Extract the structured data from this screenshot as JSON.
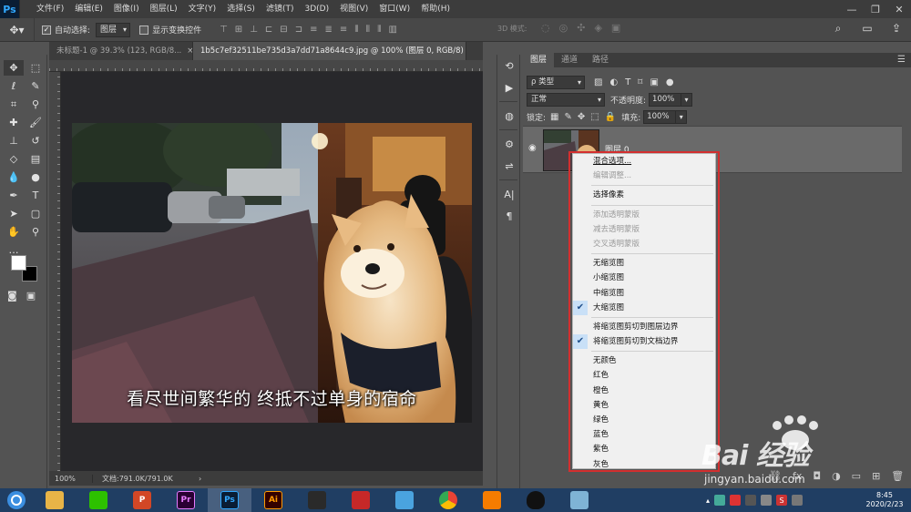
{
  "app": {
    "logo": "Ps"
  },
  "menu": [
    "文件(F)",
    "编辑(E)",
    "图像(I)",
    "图层(L)",
    "文字(Y)",
    "选择(S)",
    "滤镜(T)",
    "3D(D)",
    "视图(V)",
    "窗口(W)",
    "帮助(H)"
  ],
  "options": {
    "auto_select_label": "自动选择:",
    "auto_select_value": "图层",
    "show_transform_label": "显示变换控件",
    "mode3d_label": "3D 模式:"
  },
  "tabs": [
    {
      "label": "未标题-1 @ 39.3% (123, RGB/8...",
      "close": "×"
    },
    {
      "label": "1b5c7ef32511be735d3a7dd71a8644c9.jpg @ 100% (图层 0, RGB/8) *",
      "close": "×"
    }
  ],
  "canvas": {
    "caption": "看尽世间繁华的 终抵不过单身的宿命"
  },
  "status": {
    "zoom": "100%",
    "doc": "文档:791.0K/791.0K"
  },
  "panel": {
    "tabs": [
      "图层",
      "通道",
      "路径"
    ],
    "filter_value": "ρ 类型",
    "blend_mode": "正常",
    "opacity_label": "不透明度:",
    "opacity_value": "100%",
    "lock_label": "锁定:",
    "fill_label": "填充:",
    "fill_value": "100%",
    "layer_name": "图层 0"
  },
  "context_menu": {
    "groups": [
      [
        {
          "label": "混合选项...",
          "disabled": false,
          "checked": false
        },
        {
          "label": "编辑调整...",
          "disabled": true,
          "checked": false
        }
      ],
      [
        {
          "label": "选择像素",
          "disabled": false,
          "checked": false
        }
      ],
      [
        {
          "label": "添加透明蒙版",
          "disabled": true,
          "checked": false
        },
        {
          "label": "减去透明蒙版",
          "disabled": true,
          "checked": false
        },
        {
          "label": "交叉透明蒙版",
          "disabled": true,
          "checked": false
        }
      ],
      [
        {
          "label": "无缩览图",
          "disabled": false,
          "checked": false
        },
        {
          "label": "小缩览图",
          "disabled": false,
          "checked": false
        },
        {
          "label": "中缩览图",
          "disabled": false,
          "checked": false
        },
        {
          "label": "大缩览图",
          "disabled": false,
          "checked": true
        }
      ],
      [
        {
          "label": "将缩览图剪切到图层边界",
          "disabled": false,
          "checked": false
        },
        {
          "label": "将缩览图剪切到文档边界",
          "disabled": false,
          "checked": true
        }
      ],
      [
        {
          "label": "无颜色",
          "disabled": false,
          "checked": false
        },
        {
          "label": "红色",
          "disabled": false,
          "checked": false
        },
        {
          "label": "橙色",
          "disabled": false,
          "checked": false
        },
        {
          "label": "黄色",
          "disabled": false,
          "checked": false
        },
        {
          "label": "绿色",
          "disabled": false,
          "checked": false
        },
        {
          "label": "蓝色",
          "disabled": false,
          "checked": false
        },
        {
          "label": "紫色",
          "disabled": false,
          "checked": false
        },
        {
          "label": "灰色",
          "disabled": false,
          "checked": false
        }
      ]
    ]
  },
  "watermark": {
    "main": "Bai 经验",
    "sub": "jingyan.baidu.com"
  },
  "taskbar": {
    "apps": [
      {
        "name": "file-explorer-icon",
        "text": "",
        "color": "#e8b447"
      },
      {
        "name": "wechat-icon",
        "text": "",
        "color": "#2dc100"
      },
      {
        "name": "powerpoint-icon",
        "text": "P",
        "color": "#d24726"
      },
      {
        "name": "premiere-icon",
        "text": "Pr",
        "color": "#2a0033"
      },
      {
        "name": "photoshop-icon",
        "text": "Ps",
        "color": "#0a1d34"
      },
      {
        "name": "illustrator-icon",
        "text": "Ai",
        "color": "#330000"
      },
      {
        "name": "video-editor-icon",
        "text": "",
        "color": "#2a2a2a"
      },
      {
        "name": "wps-icon",
        "text": "",
        "color": "#c62828"
      },
      {
        "name": "cloud-app-icon",
        "text": "",
        "color": "#4aa3df"
      },
      {
        "name": "chrome-icon",
        "text": "",
        "color": "#4285f4"
      },
      {
        "name": "browser-icon",
        "text": "",
        "color": "#f57c00"
      },
      {
        "name": "qq-icon",
        "text": "",
        "color": "#111111"
      },
      {
        "name": "notes-icon",
        "text": "",
        "color": "#7fb3d5"
      }
    ],
    "time": "8:45",
    "date": "2020/2/23"
  }
}
